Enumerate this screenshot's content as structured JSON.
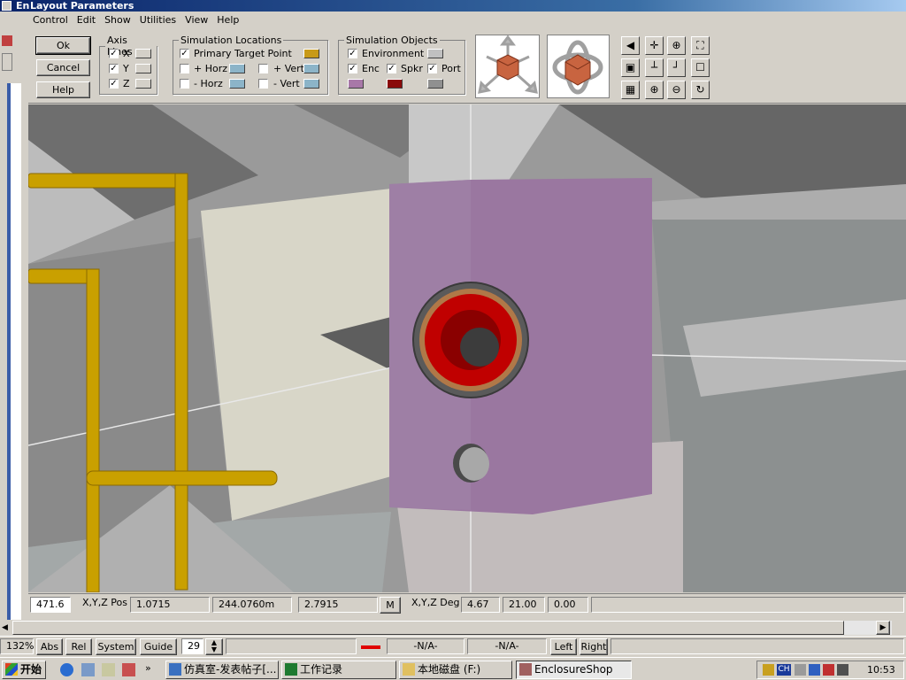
{
  "window": {
    "title": "Layout Parameters",
    "outer_title": "En"
  },
  "menu": [
    "Control",
    "Edit",
    "Show",
    "Utilities",
    "View",
    "Help"
  ],
  "dialog_buttons": {
    "ok": "Ok",
    "cancel": "Cancel",
    "help": "Help"
  },
  "axis_lines": {
    "legend": "Axis Lines",
    "items": [
      {
        "label": "X",
        "checked": true
      },
      {
        "label": "Y",
        "checked": true
      },
      {
        "label": "Z",
        "checked": true
      }
    ]
  },
  "sim_locations": {
    "legend": "Simulation Locations",
    "primary": {
      "label": "Primary Target Point",
      "checked": true,
      "color": "#c89a18"
    },
    "plus_horz": {
      "label": "+ Horz",
      "checked": false,
      "color": "#8cb4c8"
    },
    "minus_horz": {
      "label": "- Horz",
      "checked": false,
      "color": "#8cb4c8"
    },
    "plus_vert": {
      "label": "+ Vert",
      "checked": false,
      "color": "#8cb4c8"
    },
    "minus_vert": {
      "label": "- Vert",
      "checked": false,
      "color": "#8cb4c8"
    }
  },
  "sim_objects": {
    "legend": "Simulation Objects",
    "environment": {
      "label": "Environment",
      "checked": true,
      "color": "#c0c0c0"
    },
    "enc": {
      "label": "Enc",
      "checked": true,
      "color": "#a878a8"
    },
    "spkr": {
      "label": "Spkr",
      "checked": true,
      "color": "#8a0a0a"
    },
    "port": {
      "label": "Port",
      "checked": true,
      "color": "#909090"
    }
  },
  "status": {
    "zoom_value": "471.6",
    "pos_label": "X,Y,Z Pos",
    "pos_x": "1.0715",
    "pos_y": "244.0760m",
    "pos_z": "2.7915",
    "m_button": "M",
    "deg_label": "X,Y,Z Deg",
    "deg_x": "4.67",
    "deg_y": "21.00",
    "deg_z": "0.00"
  },
  "bottom": {
    "zoom": "132%",
    "abs": "Abs",
    "rel": "Rel",
    "system": "System",
    "guide": "Guide",
    "guide_value": "29",
    "na1": "-N/A-",
    "na2": "-N/A-",
    "left": "Left",
    "right": "Right"
  },
  "taskbar": {
    "start": "开始",
    "tasks": [
      {
        "label": "仿真室-发表帖子[..."
      },
      {
        "label": "工作记录"
      },
      {
        "label": "本地磁盘 (F:)"
      },
      {
        "label": "EnclosureShop"
      }
    ],
    "lang": "CH",
    "clock": "10:53"
  },
  "colors": {
    "enclosure": "#9a77a0",
    "pipe": "#c9a000",
    "speaker": "#b00000"
  }
}
